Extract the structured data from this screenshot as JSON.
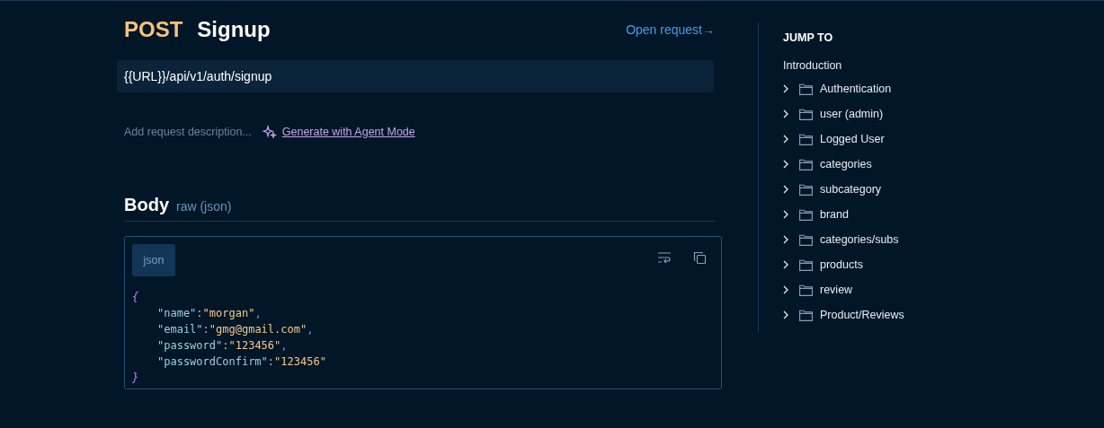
{
  "request": {
    "method": "POST",
    "name": "Signup",
    "open_link": "Open request→",
    "url": "{{URL}}/api/v1/auth/signup",
    "description_placeholder": "Add request description...",
    "agent_link": "Generate with Agent Mode"
  },
  "body": {
    "title": "Body",
    "mode": "raw (json)",
    "language": "json",
    "lines": [
      {
        "kind": "brace",
        "text": "{"
      },
      {
        "kind": "pair",
        "key": "\"name\"",
        "colon": ":",
        "value": "\"morgan\"",
        "comma": ","
      },
      {
        "kind": "pair",
        "key": "\"email\"",
        "colon": ":",
        "value": "\"gmg@gmail.com\"",
        "comma": ","
      },
      {
        "kind": "pair",
        "key": "\"password\"",
        "colon": ":",
        "value": "\"123456\"",
        "comma": ","
      },
      {
        "kind": "pair",
        "key": "\"passwordConfirm\"",
        "colon": ":",
        "value": "\"123456\""
      },
      {
        "kind": "brace",
        "text": "}"
      }
    ]
  },
  "sidebar": {
    "title": "JUMP TO",
    "intro": "Introduction",
    "items": [
      {
        "label": "Authentication",
        "expanded": false
      },
      {
        "label": "user (admin)",
        "expanded": false
      },
      {
        "label": "Logged User",
        "expanded": false
      },
      {
        "label": "categories",
        "expanded": false
      },
      {
        "label": "subcategory",
        "expanded": false
      },
      {
        "label": "brand",
        "expanded": false
      },
      {
        "label": "categories/subs",
        "expanded": false
      },
      {
        "label": "products",
        "expanded": false
      },
      {
        "label": "review",
        "expanded": false
      },
      {
        "label": "Product/Reviews",
        "expanded": false
      }
    ]
  }
}
